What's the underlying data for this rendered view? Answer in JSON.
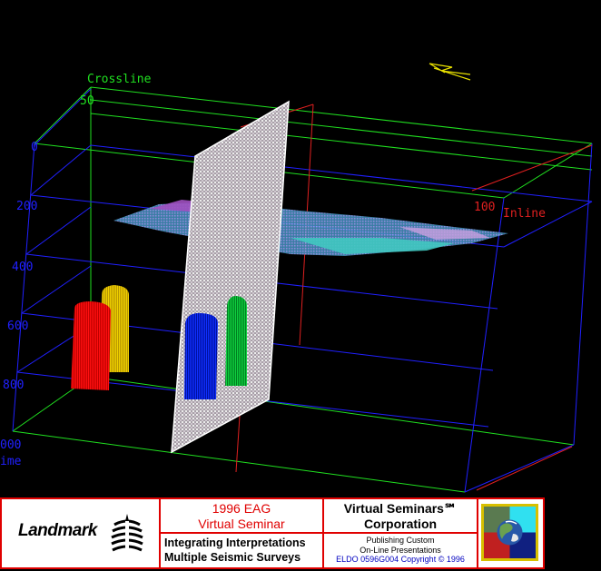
{
  "viewport": {
    "axes": {
      "crossline_label": "Crossline",
      "crossline_tick": "50",
      "inline_label": "Inline",
      "inline_tick": "100",
      "time_ticks": [
        "0",
        "200",
        "400",
        "600",
        "800",
        "000"
      ],
      "time_label": "ime"
    },
    "colors": {
      "background": "#000000",
      "grid_green": "#20e020",
      "grid_blue": "#2020ff",
      "grid_red": "#e02020",
      "crossline_text": "#20e020",
      "inline_text": "#e02020",
      "time_text": "#2020ff",
      "well_red": "#ff1010",
      "well_yellow": "#f0d000",
      "well_blue": "#1030ff",
      "well_green": "#10d040",
      "marker_yellow": "#e8e000"
    }
  },
  "footer": {
    "company_logo": "Landmark",
    "seminar_title_line1": "1996 EAG",
    "seminar_title_line2": "Virtual Seminar",
    "seminar_subtitle_line1": "Integrating Interpretations",
    "seminar_subtitle_line2": "Multiple Seismic Surveys",
    "vsc_name_line1": "Virtual Seminars℠",
    "vsc_name_line2": "Corporation",
    "vsc_tagline_line1": "Publishing Custom",
    "vsc_tagline_line2": "On-Line Presentations",
    "vsc_copyright": "ELDO 0596G004 Copyright © 1996",
    "colors": {
      "border": "#e00000",
      "seminar_title": "#e00000",
      "copyright": "#0000c0",
      "globe_frame": "#d8c000"
    }
  }
}
